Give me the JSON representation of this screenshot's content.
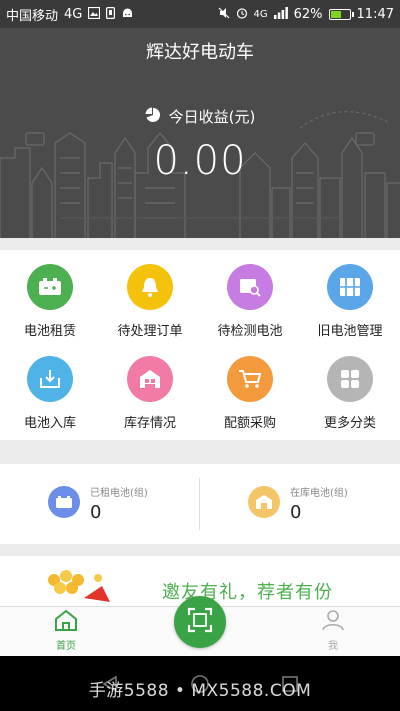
{
  "status_bar": {
    "carrier": "中国移动",
    "network": "4G",
    "network_right": "4G",
    "battery_percent_text": "62%",
    "battery_level": 0.62,
    "time": "11:47",
    "icons": [
      "image-icon",
      "sim-icon",
      "android-icon",
      "mute-icon",
      "alarm-icon",
      "signal-icon",
      "battery-icon"
    ]
  },
  "header": {
    "title": "辉达好电动车",
    "earnings_label": "今日收益(元)",
    "earnings_value": "0.00",
    "bg_color": "#4b4b4b"
  },
  "grid": {
    "items": [
      {
        "label": "电池租赁",
        "icon": "battery-icon",
        "color": "#4caf50"
      },
      {
        "label": "待处理订单",
        "icon": "bell-icon",
        "color": "#f5c20b"
      },
      {
        "label": "待检测电池",
        "icon": "inspect-icon",
        "color": "#c77ce3"
      },
      {
        "label": "旧电池管理",
        "icon": "grid-box-icon",
        "color": "#5aa6e8"
      },
      {
        "label": "电池入库",
        "icon": "inbox-icon",
        "color": "#4fb3e8"
      },
      {
        "label": "库存情况",
        "icon": "warehouse-icon",
        "color": "#f27aa6"
      },
      {
        "label": "配额采购",
        "icon": "cart-icon",
        "color": "#f29a3c"
      },
      {
        "label": "更多分类",
        "icon": "category-icon",
        "color": "#b5b5b5"
      }
    ]
  },
  "stats": {
    "rented": {
      "label": "已租电池(组)",
      "value": "0",
      "color": "#6b8fe8"
    },
    "stock": {
      "label": "在库电池(组)",
      "value": "0",
      "color": "#f5c56a"
    }
  },
  "banner": {
    "text": "邀友有礼，荐者有份"
  },
  "tabbar": {
    "home": "首页",
    "me": "我",
    "active_color": "#3aa346",
    "inactive_color": "#aaaaaa"
  },
  "watermark": "手游5588 • MX5588.COM"
}
